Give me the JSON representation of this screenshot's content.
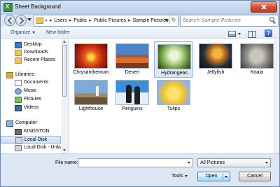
{
  "window": {
    "title": "Sheet Background"
  },
  "address": {
    "crumbs": [
      "«",
      "Users",
      "Public",
      "Public Pictures",
      "Sample Pictures"
    ],
    "search_placeholder": "Search Sample Pictures"
  },
  "toolbar": {
    "organize": "Organize",
    "new_folder": "New folder"
  },
  "sidebar": {
    "items": [
      {
        "label": "Desktop"
      },
      {
        "label": "Downloads"
      },
      {
        "label": "Recent Places"
      },
      {
        "label": "Libraries"
      },
      {
        "label": "Documents"
      },
      {
        "label": "Music"
      },
      {
        "label": "Pictures"
      },
      {
        "label": "Videos"
      },
      {
        "label": "Computer"
      },
      {
        "label": "KINGSTON"
      },
      {
        "label": "Local Disk"
      },
      {
        "label": "Local Disk - Unla"
      }
    ]
  },
  "files": [
    {
      "name": "Chrysanthemum"
    },
    {
      "name": "Desert"
    },
    {
      "name": "Hydrangeas"
    },
    {
      "name": "Jellyfish"
    },
    {
      "name": "Koala"
    },
    {
      "name": "Lighthouse"
    },
    {
      "name": "Penguins"
    },
    {
      "name": "Tulips"
    }
  ],
  "footer": {
    "file_name_label": "File name:",
    "file_name_value": "",
    "filter": "All Pictures",
    "tools": "Tools",
    "open": "Open",
    "cancel": "Cancel"
  }
}
